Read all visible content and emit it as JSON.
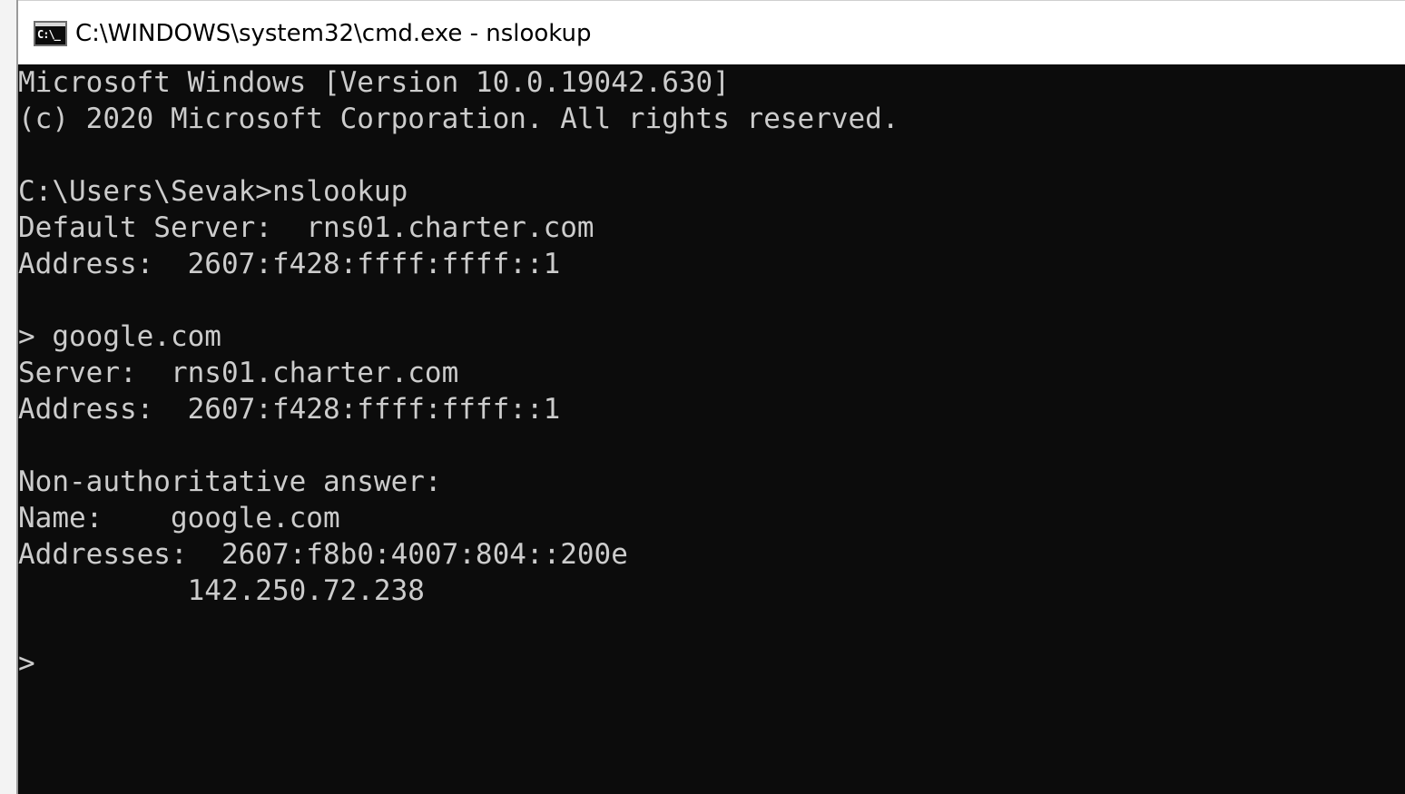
{
  "window": {
    "title": "C:\\WINDOWS\\system32\\cmd.exe - nslookup",
    "icon_name": "cmd-icon",
    "icon_text": "C:\\_"
  },
  "console": {
    "background": "#0c0c0c",
    "foreground": "#cccccc",
    "lines": [
      "Microsoft Windows [Version 10.0.19042.630]",
      "(c) 2020 Microsoft Corporation. All rights reserved.",
      "",
      "C:\\Users\\Sevak>nslookup",
      "Default Server:  rns01.charter.com",
      "Address:  2607:f428:ffff:ffff::1",
      "",
      "> google.com",
      "Server:  rns01.charter.com",
      "Address:  2607:f428:ffff:ffff::1",
      "",
      "Non-authoritative answer:",
      "Name:    google.com",
      "Addresses:  2607:f8b0:4007:804::200e",
      "          142.250.72.238",
      "",
      ">"
    ]
  }
}
